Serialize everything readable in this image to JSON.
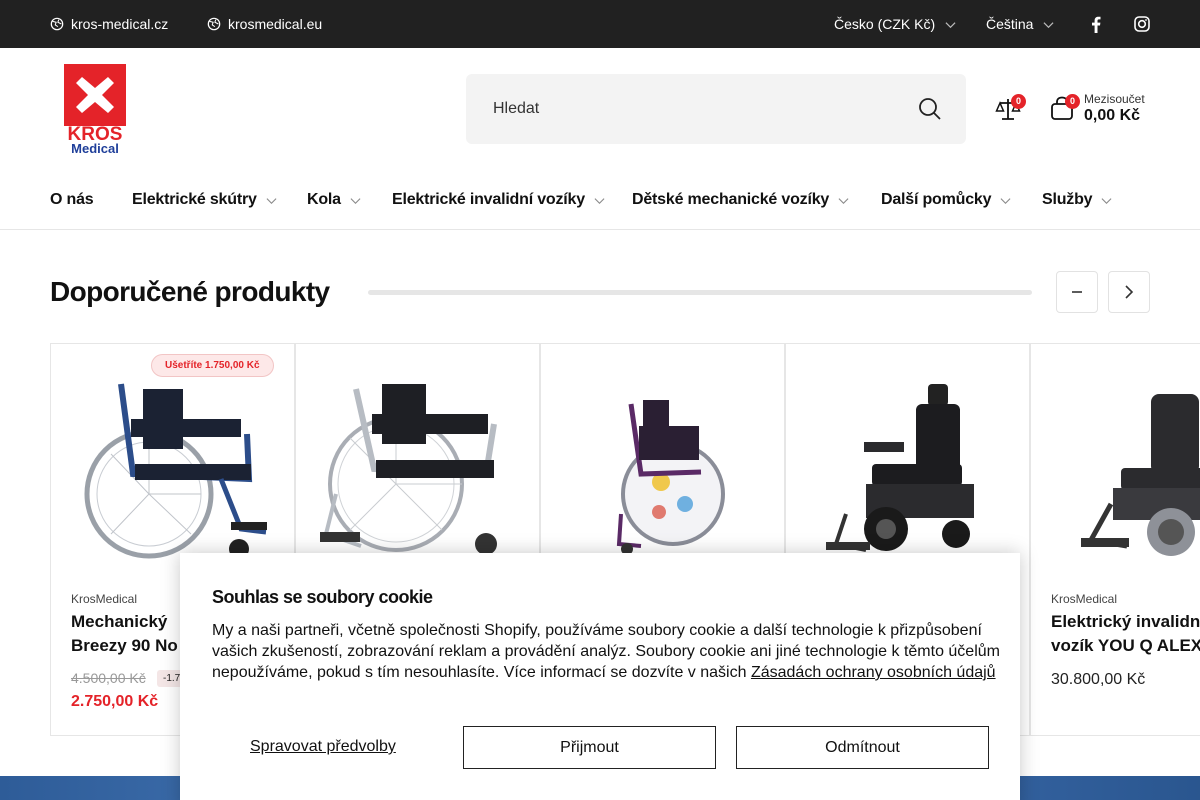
{
  "topbar": {
    "sites": [
      "kros-medical.cz",
      "krosmedical.eu"
    ],
    "currency": "Česko (CZK Kč)",
    "language": "Čeština",
    "social": [
      "facebook-icon",
      "instagram-icon"
    ]
  },
  "logo": {
    "line1": "KROS",
    "line2": "Medical"
  },
  "search": {
    "placeholder": "Hledat"
  },
  "header": {
    "compare_count": "0",
    "cart_count": "0",
    "subtotal_label": "Mezisoučet",
    "subtotal_value": "0,00 Kč"
  },
  "nav": {
    "items": [
      {
        "label": "O nás"
      },
      {
        "label": "Elektrické skútry"
      },
      {
        "label": "Kola"
      },
      {
        "label": "Elektrické invalidní vozíky"
      },
      {
        "label": "Dětské mechanické vozíky"
      },
      {
        "label": "Další pomůcky"
      },
      {
        "label": "Služby"
      }
    ]
  },
  "section": {
    "title": "Doporučené produkty"
  },
  "products": [
    {
      "save_badge": "Ušetříte 1.750,00 Kč",
      "vendor": "KrosMedical",
      "name_line1": "Mechanický",
      "name_line2": "Breezy 90 No",
      "old_price": "4.500,00 Kč",
      "discount": "-1.7",
      "price": "2.750,00 Kč"
    },
    {
      "vendor": "",
      "name_line1": "",
      "name_line2": "",
      "price": ""
    },
    {
      "vendor": "",
      "name_line1": "",
      "name_line2": "",
      "price": ""
    },
    {
      "vendor": "",
      "name_line1": "",
      "name_line2": "",
      "price": ""
    },
    {
      "vendor": "KrosMedical",
      "name_line1": "Elektrický invalidn",
      "name_line2": "vozík YOU Q ALEX",
      "price": "30.800,00 Kč"
    }
  ],
  "cookie": {
    "title": "Souhlas se soubory cookie",
    "message": "My a naši partneři, včetně společnosti Shopify, používáme soubory cookie a další technologie k přizpůsobení vašich zkušeností, zobrazování reklam a provádění analýz. Soubory cookie ani jiné technologie k těmto účelům nepoužíváme, pokud s tím nesouhlasíte. Více informací se dozvíte v našich",
    "link": "Zásadách ochrany osobních údajů",
    "manage": "Spravovat předvolby",
    "accept": "Přijmout",
    "decline": "Odmítnout"
  },
  "colors": {
    "brand_red": "#e42329",
    "brand_blue": "#1f3f9a",
    "topbar": "#212121"
  }
}
